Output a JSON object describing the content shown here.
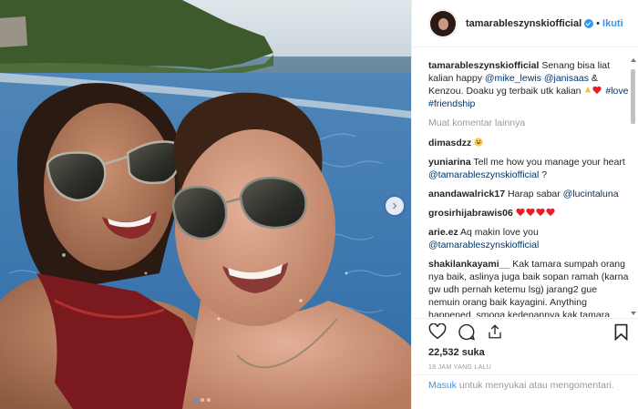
{
  "post": {
    "username": "tamarableszynskiofficial",
    "separator": "•",
    "follow_label": "Ikuti",
    "caption": {
      "username": "tamarableszynskiofficial",
      "text_1": "Senang bisa liat kalian happy ",
      "mention_1": "@mike_lewis",
      "mention_2": "@janisaas",
      "text_2": " & Kenzou. Doaku yg terbaik utk kalian ",
      "hashtag_1": "#love",
      "hashtag_2": "#friendship"
    },
    "load_more": "Muat komentar lainnya",
    "comments": [
      {
        "user": "dimasdzz",
        "text": ""
      },
      {
        "user": "yuniarina",
        "text": "Tell me how you manage your heart ",
        "mention": "@tamarableszynskiofficial",
        "tail": " ?"
      },
      {
        "user": "anandawalrick17",
        "text": "Harap sabar ",
        "mention": "@lucintaluna"
      },
      {
        "user": "grosirhijabrawis06",
        "text": ""
      },
      {
        "user": "arie.ez",
        "text": "Aq makin love you ",
        "mention": "@tamarableszynskiofficial"
      },
      {
        "user": "shakilankayami__",
        "text": " Kak tamara sumpah orang nya baik, aslinya juga baik sopan ramah (karna gw udh pernah ketemu lsg) jarang2 gue nemuin orang baik kayagini. Anything happened, smoga kedepannya kak tamara life's getting better and better"
      }
    ],
    "likes": "22,532 suka",
    "time": "18 JAM YANG LALU",
    "login": {
      "link": "Masuk",
      "text": " untuk menyukai atau mengomentari."
    }
  },
  "carousel": {
    "slide_count": 3,
    "active_index": 0
  },
  "colors": {
    "link": "#003569",
    "accent": "#3897f0",
    "muted": "#999999",
    "heart": "#ed1c24"
  }
}
